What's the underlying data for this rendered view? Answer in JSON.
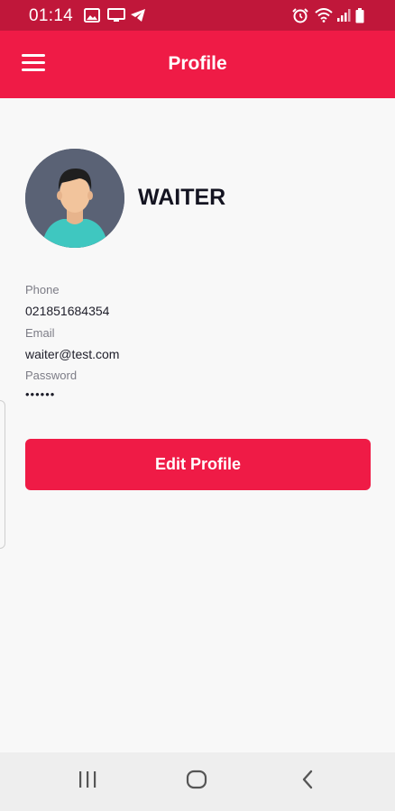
{
  "status_bar": {
    "time": "01:14",
    "left_icons": [
      "image-icon",
      "screen-icon",
      "telegram-icon"
    ],
    "right_icons": [
      "alarm-icon",
      "wifi-icon",
      "signal-icon",
      "battery-icon"
    ]
  },
  "app_bar": {
    "title": "Profile",
    "menu_icon": "hamburger-menu-icon"
  },
  "profile": {
    "name": "WAITER",
    "avatar_icon": "user-avatar"
  },
  "fields": {
    "phone_label": "Phone",
    "phone_value": "021851684354",
    "email_label": "Email",
    "email_value": "waiter@test.com",
    "password_label": "Password",
    "password_value": "••••••"
  },
  "actions": {
    "edit_profile_label": "Edit Profile"
  },
  "nav_bar": {
    "buttons": [
      "recents-icon",
      "home-icon",
      "back-icon"
    ]
  },
  "colors": {
    "primary": "#ef1b46",
    "status_bar": "#c0173a",
    "background": "#f8f8f8",
    "avatar_bg": "#5a6275",
    "shirt": "#3fc7c0"
  }
}
